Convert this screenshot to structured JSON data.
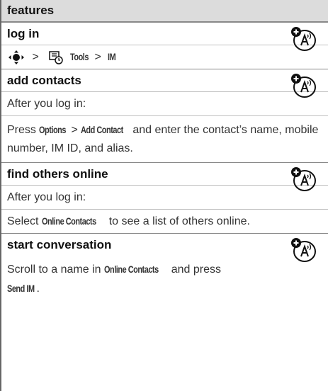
{
  "header": {
    "title": "features"
  },
  "icons": {
    "carrier": "carrier-dependent-feature-icon",
    "nav": "navigation-key-icon",
    "tools": "tools-menu-icon"
  },
  "sections": {
    "log_in": {
      "title": "log in",
      "path_sep1": ">",
      "path_tools": "Tools",
      "path_sep2": ">",
      "path_im": "IM"
    },
    "add_contacts": {
      "title": "add contacts",
      "line1": "After you log in:",
      "press": "Press ",
      "options": "Options",
      "sep": " > ",
      "add_contact": "Add Contact",
      "rest": " and enter the contact’s name, mobile number, IM ID, and alias."
    },
    "find_others": {
      "title": "find others online",
      "line1": "After you log in:",
      "select": "Select ",
      "online_contacts": "Online Contacts",
      "rest": " to see a list of others online."
    },
    "start_conversation": {
      "title": "start conversation",
      "scroll": "Scroll to a name in ",
      "online_contacts": "Online Contacts",
      "and_press": " and press ",
      "send_im": "Send IM",
      "period": "."
    }
  }
}
